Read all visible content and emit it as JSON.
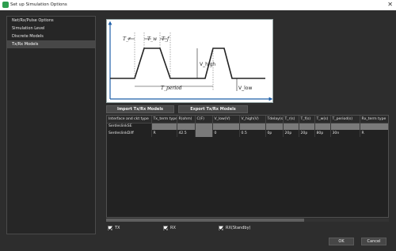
{
  "window": {
    "title": "Set up Simulation Options",
    "close_glyph": "✕"
  },
  "sidebar": {
    "items": [
      {
        "label": "Net/Rx/Pulse Options"
      },
      {
        "label": "Simulation Level"
      },
      {
        "label": "Discrete Models"
      },
      {
        "label": "Tx/Rx Models",
        "selected": true
      }
    ]
  },
  "diagram": {
    "labels": {
      "t_r": "T_r",
      "t_w": "T_w",
      "t_f": "T_f",
      "t_period": "T_period",
      "v_high": "V_high",
      "v_low": "V_low"
    }
  },
  "buttons": {
    "import": "Import Tx/Rx Models",
    "export": "Export Tx/Rx Models"
  },
  "table": {
    "columns": [
      "Interface and ckt type",
      "Tx_term type",
      "R(ohm)",
      "C(F)",
      "V_low(V)",
      "V_high(V)",
      "Tdelay(s)",
      "T_r(s)",
      "T_f(s)",
      "T_w(s)",
      "T_period(s)",
      "Rx_term type"
    ],
    "rows": [
      {
        "cells": [
          "SerdeslinkSE",
          "",
          "",
          "",
          "",
          "",
          "",
          "",
          "",
          "",
          "",
          ""
        ]
      },
      {
        "cells": [
          "SerdeslinkDiff",
          "R",
          "42.5",
          "",
          "0",
          "0.5",
          "0p",
          "20p",
          "20p",
          "80p",
          "30n",
          "R"
        ]
      }
    ]
  },
  "checkboxes": [
    {
      "label": "TX",
      "checked": true
    },
    {
      "label": "RX",
      "checked": true
    },
    {
      "label": "RX(Standby)",
      "checked": true
    }
  ],
  "footer": {
    "ok": "OK",
    "cancel": "Cancel"
  }
}
